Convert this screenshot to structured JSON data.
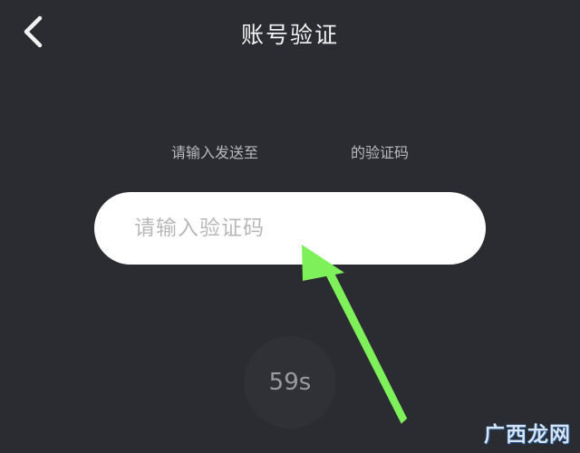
{
  "header": {
    "title": "账号验证",
    "back_icon": "chevron-left-icon"
  },
  "hint": {
    "prefix": "请输入发送至",
    "suffix": "的验证码"
  },
  "code_input": {
    "placeholder": "请输入验证码",
    "value": ""
  },
  "countdown": {
    "label": "59s"
  },
  "annotation": {
    "arrow_color": "#7ef05a"
  },
  "watermark": {
    "text": "广西龙网"
  },
  "colors": {
    "background": "#2b2c31",
    "input_background": "#ffffff",
    "countdown_background": "#303136"
  }
}
